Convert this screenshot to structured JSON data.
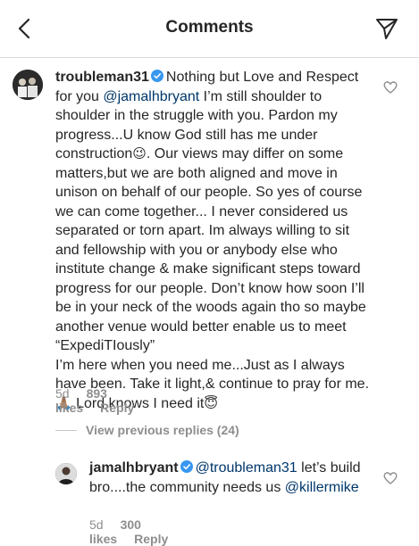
{
  "header": {
    "title": "Comments"
  },
  "comments": [
    {
      "username": "troubleman31",
      "text_before_mention": "Nothing but Love and Respect for you ",
      "mention": "@jamalhbryant",
      "text_after_mention": " I’m still shoulder to shoulder in the struggle with you. Pardon my progress...U know God still has me under construction",
      "emoji1": "😉",
      "text_middle": ". Our views may differ on some matters,but we are both aligned and move in unison on behalf of our people. So yes of course we can come together... I never considered us separated or torn apart. Im always willing to sit and fellowship with you or anybody else who institute change & make significant steps toward progress for our people. Don’t know how soon I’ll be in your neck of the woods again tho so maybe another venue would better enable us to meet “ExpediTIously”",
      "text_line2": "I’m here when you need me...Just as I always have been. Take it light,& continue to pray for me.",
      "emoji2": "🙏🏽",
      "text_end": " Lord knows I need it",
      "emoji3": "😇",
      "time": "5d",
      "likes": "893 likes",
      "reply_label": "Reply"
    },
    {
      "username": "jamalhbryant",
      "mention1": "@troubleman31",
      "text_middle": " let’s build bro....the community needs us ",
      "mention2": "@killermike",
      "time": "5d",
      "likes": "300 likes",
      "reply_label": "Reply"
    }
  ],
  "view_previous": "View previous replies (24)",
  "icons": {
    "back": "back-arrow-icon",
    "share": "direct-share-icon",
    "verified": "verified-badge-icon",
    "like": "heart-icon"
  },
  "colors": {
    "verified": "#3897f0",
    "mention": "#00376b",
    "meta": "#8e8e8e"
  }
}
